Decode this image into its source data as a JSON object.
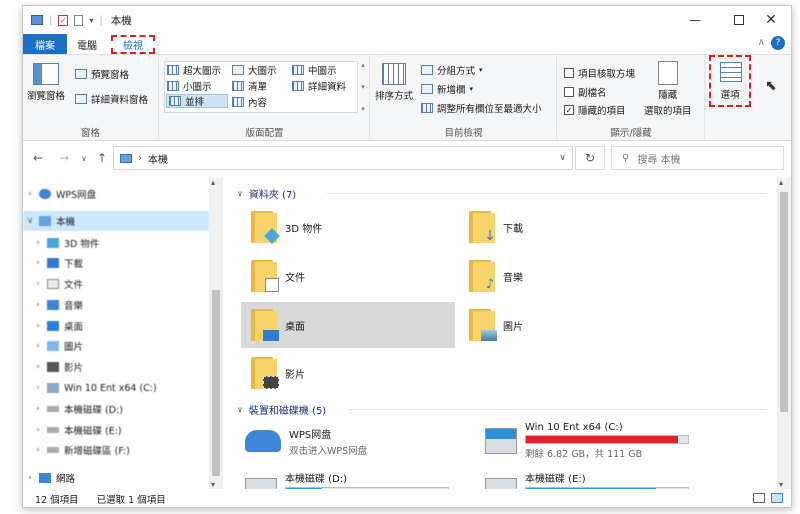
{
  "window": {
    "title": "本機"
  },
  "tabs": {
    "file": "檔案",
    "computer": "電腦",
    "view": "檢視"
  },
  "ribbon": {
    "panes": {
      "nav_pane": "瀏覽窗格",
      "preview_pane": "預覽窗格",
      "details_pane": "詳細資料窗格",
      "label": "窗格"
    },
    "layout": {
      "extra_large": "超大圖示",
      "large": "大圖示",
      "medium": "中圖示",
      "small": "小圖示",
      "list": "清單",
      "details": "詳細資料",
      "tiles": "並排",
      "content": "內容",
      "label": "版面配置"
    },
    "current_view": {
      "sort_by": "排序方式",
      "group_by": "分組方式",
      "add_columns": "新增欄",
      "size_all_columns": "調整所有欄位至最適大小",
      "label": "目前檢視"
    },
    "show_hide": {
      "item_check_boxes": "項目核取方塊",
      "file_name_extensions": "副檔名",
      "hidden_items": "隱藏的項目",
      "hide_selected": "隱藏",
      "hide_selected_2": "選取的項目",
      "label": "顯示/隱藏"
    },
    "options": {
      "label": "選項"
    }
  },
  "address": {
    "path": "本機",
    "search_placeholder": "搜尋 本機"
  },
  "navpane": {
    "items": [
      {
        "label": "WPS网盘",
        "icon": "cloud-icon"
      },
      {
        "label": "本機",
        "icon": "computer-icon"
      },
      {
        "label": "3D 物件",
        "icon": "cube-icon"
      },
      {
        "label": "下載",
        "icon": "download-icon"
      },
      {
        "label": "文件",
        "icon": "document-icon"
      },
      {
        "label": "音樂",
        "icon": "music-icon"
      },
      {
        "label": "桌面",
        "icon": "desktop-icon"
      },
      {
        "label": "圖片",
        "icon": "picture-icon"
      },
      {
        "label": "影片",
        "icon": "video-icon"
      },
      {
        "label": "Win 10 Ent x64 (C:)",
        "icon": "drive-icon"
      },
      {
        "label": "本機磁碟 (D:)",
        "icon": "drive-icon"
      },
      {
        "label": "本機磁碟 (E:)",
        "icon": "drive-icon"
      },
      {
        "label": "新增磁碟區 (F:)",
        "icon": "drive-icon"
      },
      {
        "label": "網路",
        "icon": "network-icon"
      }
    ]
  },
  "content": {
    "folders_header": "資料夾 (7)",
    "folders": [
      {
        "label": "3D 物件",
        "icon": "cube-icon"
      },
      {
        "label": "下載",
        "icon": "download-icon"
      },
      {
        "label": "文件",
        "icon": "document-icon"
      },
      {
        "label": "音樂",
        "icon": "music-icon"
      },
      {
        "label": "桌面",
        "icon": "desktop-icon"
      },
      {
        "label": "圖片",
        "icon": "picture-icon"
      },
      {
        "label": "影片",
        "icon": "video-icon"
      }
    ],
    "devices_header": "裝置和磁碟機 (5)",
    "wps": {
      "label": "WPS网盘",
      "sub": "双击进入WPS网盘"
    },
    "drive_c": {
      "label": "Win 10 Ent x64 (C:)",
      "sub": "剩餘 6.82 GB，共 111 GB",
      "used_fraction": 0.94,
      "fill_color": "#da2626"
    },
    "drive_d": {
      "label": "本機磁碟 (D:)",
      "used_fraction": 0.22,
      "fill_color": "#26a0da"
    },
    "drive_e": {
      "label": "本機磁碟 (E:)",
      "used_fraction": 0.8,
      "fill_color": "#26a0da"
    }
  },
  "status": {
    "count": "12 個項目",
    "selected": "已選取 1 個項目"
  }
}
